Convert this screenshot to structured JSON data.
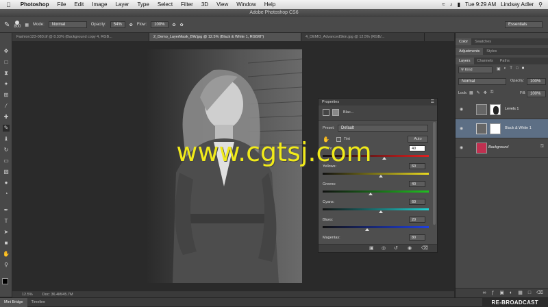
{
  "menubar": {
    "app": "Photoshop",
    "items": [
      "File",
      "Edit",
      "Image",
      "Layer",
      "Type",
      "Select",
      "Filter",
      "3D",
      "View",
      "Window",
      "Help"
    ],
    "clock": "Tue 9:29 AM",
    "user": "Lindsay Adler"
  },
  "titlebar": {
    "title": "Adobe Photoshop CS6"
  },
  "options": {
    "brush_size": "800",
    "mode_label": "Mode:",
    "mode_value": "Normal",
    "opacity_label": "Opacity:",
    "opacity_value": "54%",
    "flow_label": "Flow:",
    "flow_value": "100%",
    "workspace": "Essentials"
  },
  "tabs": [
    {
      "label": "Fashion123-083.tif @ 8.33% (Background copy 4, RGB..."
    },
    {
      "label": "2_Demo_LayerMask_BW.jpg @ 12.5% (Black & White 1, RGB/8*)"
    },
    {
      "label": "4_DEMO_AdvancedSkin.jpg @ 12.5% (RGB/..."
    }
  ],
  "status": {
    "zoom": "12.5%",
    "doc": "Doc: 36.4M/45.7M"
  },
  "bottombar": {
    "tab1": "Mini Bridge",
    "tab2": "Timeline",
    "broadcast": "RE-BROADCAST"
  },
  "properties": {
    "title": "Properties",
    "adj_name": "Blac...",
    "preset_label": "Preset:",
    "preset_value": "Default",
    "tint_label": "Tint",
    "auto_label": "Auto",
    "sliders": [
      {
        "label": "Reds:",
        "value": "40",
        "fraction": 0.58,
        "gradient": "linear-gradient(90deg,#111,#e02020)"
      },
      {
        "label": "Yellows:",
        "value": "60",
        "fraction": 0.55,
        "gradient": "linear-gradient(90deg,#111,#e8d820)"
      },
      {
        "label": "Greens:",
        "value": "40",
        "fraction": 0.45,
        "gradient": "linear-gradient(90deg,#111,#20c020)"
      },
      {
        "label": "Cyans:",
        "value": "60",
        "fraction": 0.55,
        "gradient": "linear-gradient(90deg,#111,#20d0d0)"
      },
      {
        "label": "Blues:",
        "value": "20",
        "fraction": 0.42,
        "gradient": "linear-gradient(90deg,#111,#2040e0)"
      },
      {
        "label": "Magentas:",
        "value": "80",
        "fraction": 0.7,
        "gradient": "linear-gradient(90deg,#111,#d020d0)"
      }
    ]
  },
  "rightpanel": {
    "tabs_top": [
      "Color",
      "Swatches"
    ],
    "tabs_mid": [
      "Adjustments",
      "Styles"
    ],
    "tabs_layers": [
      "Layers",
      "Channels",
      "Paths"
    ],
    "kind": "Kind",
    "blend": "Normal",
    "opacity_label": "Opacity:",
    "opacity_value": "100%",
    "lock_label": "Lock:",
    "fill_label": "Fill:",
    "fill_value": "100%",
    "layers": [
      {
        "name": "Levels 1"
      },
      {
        "name": "Black & White 1"
      },
      {
        "name": "Background"
      }
    ]
  },
  "watermark": "www.cgtsj.com"
}
